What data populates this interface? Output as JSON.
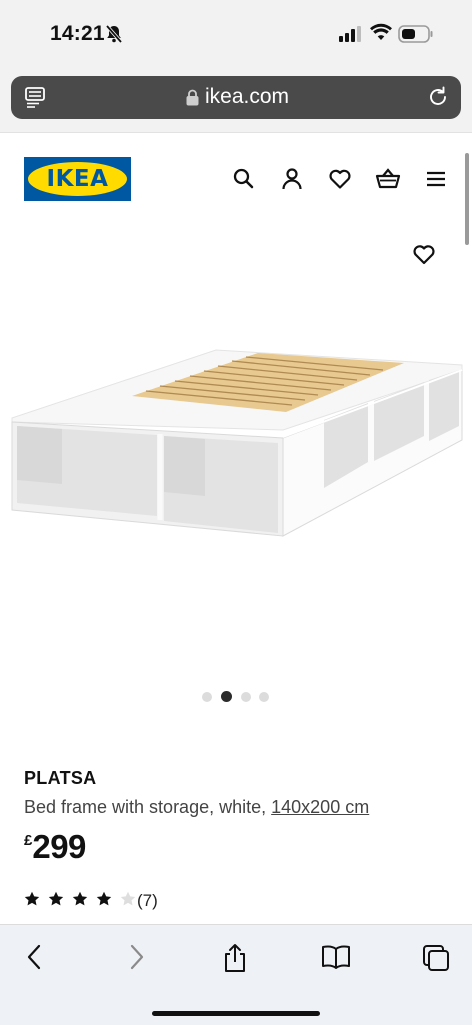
{
  "status_bar": {
    "time": "14:21",
    "icons": [
      "bell-slash-icon",
      "signal-icon",
      "wifi-icon",
      "battery-icon"
    ]
  },
  "browser": {
    "url": "ikea.com",
    "icons": [
      "reader-icon",
      "lock-icon",
      "reload-icon"
    ]
  },
  "header": {
    "logo_text": "IKEA",
    "icons": [
      "search-icon",
      "account-icon",
      "favourites-icon",
      "basket-icon",
      "menu-icon"
    ]
  },
  "gallery": {
    "image_count": 4,
    "active_index": 1,
    "favourite_icon": "heart-icon"
  },
  "product": {
    "name": "PLATSA",
    "description": "Bed frame with storage, white,",
    "dimensions": "140x200 cm",
    "currency": "£",
    "price": "299",
    "rating_value": 4,
    "rating_max": 5,
    "review_count": "(7)"
  },
  "toolbar": {
    "icons": [
      "back-icon",
      "forward-icon",
      "share-icon",
      "bookmarks-icon",
      "tabs-icon"
    ]
  },
  "colors": {
    "ikea_blue": "#0058a3",
    "ikea_yellow": "#ffdb00",
    "address_bar": "#4a4a4a",
    "toolbar_bg": "#eef1f6"
  }
}
